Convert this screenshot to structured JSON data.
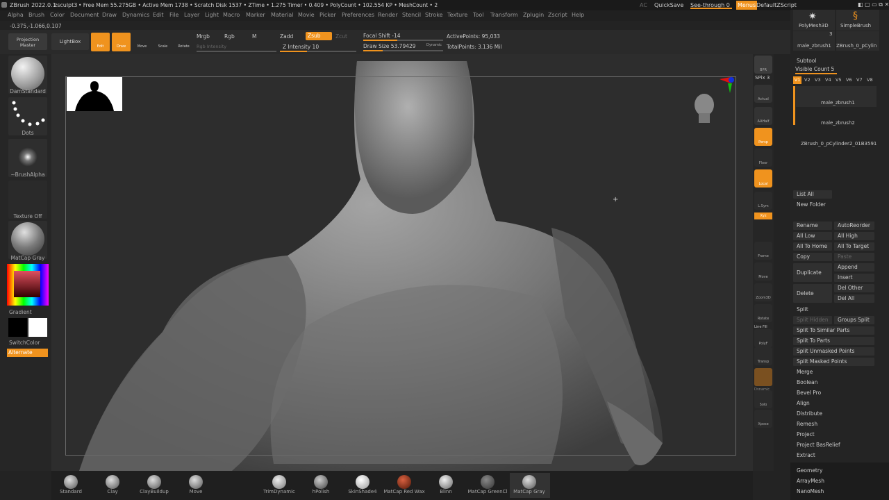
{
  "titlebar": {
    "app": "ZBrush 2022.0.1",
    "doc": "zsculpt3",
    "stats": "• Free Mem 55.275GB • Active Mem 1738 • Scratch Disk 1537 • ZTime • 1.275 Timer • 0.409 • PolyCount • 102.554 KP • MeshCount • 2",
    "ac": "AC",
    "quicksave": "QuickSave",
    "seethrough": "See-through",
    "seethrough_val": "0",
    "menus": "Menus",
    "script": "DefaultZScript"
  },
  "menu": [
    "Alpha",
    "Brush",
    "Color",
    "Document",
    "Draw",
    "Dynamics",
    "Edit",
    "File",
    "Layer",
    "Light",
    "Macro",
    "Marker",
    "Material",
    "Movie",
    "Picker",
    "Preferences",
    "Render",
    "Stencil",
    "Stroke",
    "Texture",
    "Tool",
    "Transform",
    "Zplugin",
    "Zscript",
    "Help"
  ],
  "coord": "-0.375,-1.066,0.107",
  "toolbar": {
    "projection_master": "Projection Master",
    "lightbox": "LightBox",
    "edit": "Edit",
    "draw": "Draw",
    "move": "Move",
    "scale": "Scale",
    "rotate": "Rotate",
    "mrgb": "Mrgb",
    "rgb": "Rgb",
    "m": "M",
    "rgb_intensity": "Rgb Intensity",
    "zadd": "Zadd",
    "zsub": "Zsub",
    "zcut": "Zcut",
    "z_intensity": "Z Intensity 10",
    "z_intensity_level": 0.35,
    "focal_shift": "Focal Shift -14",
    "focal_shift_level": 0.43,
    "draw_size": "Draw Size 53.79429",
    "draw_size_level": 0.24,
    "dynamic": "Dynamic",
    "active_points": "ActivePoints: 95,033",
    "total_points": "TotalPoints: 3.136 Mil"
  },
  "left": {
    "brush": "DamStandard",
    "stroke": "Dots",
    "alpha": "~BrushAlpha",
    "texture": "Texture Off",
    "material": "MatCap Gray",
    "gradient": "Gradient",
    "switch": "SwitchColor",
    "alternate": "Alternate"
  },
  "right_shelf": [
    "BPR",
    "SPix 3",
    "Actual",
    "AAHalf",
    "Persp",
    "Floor",
    "Local",
    "L.Sym",
    "Xyz",
    "Frame",
    "Move",
    "Zoom3D",
    "Rotate",
    "Line Fill",
    "PolyF",
    "Transp",
    "Dynamic",
    "Solo",
    "Xpose"
  ],
  "tray": {
    "polymesh": "PolyMesh3D",
    "simplebrush": "SimpleBrush",
    "male1": "male_zbrush1",
    "count3": "3",
    "pcyl": "ZBrush_0_pCylin",
    "subtool": "Subtool",
    "visible_count": "Visible Count 5",
    "versions": [
      "V1",
      "V2",
      "V3",
      "V4",
      "V5",
      "V6",
      "V7",
      "V8"
    ],
    "items": [
      "male_zbrush1",
      "male_zbrush2",
      "ZBrush_0_pCylinder2_01B3591"
    ],
    "list_all": "List All",
    "new_folder": "New Folder",
    "rename": "Rename",
    "autoreorder": "AutoReorder",
    "all_low": "All Low",
    "all_high": "All High",
    "all_home": "All To Home",
    "all_target": "All To Target",
    "copy": "Copy",
    "paste": "Paste",
    "duplicate": "Duplicate",
    "append": "Append",
    "insert": "Insert",
    "delete": "Delete",
    "del_other": "Del Other",
    "del_all": "Del All",
    "split": "Split",
    "split_hidden": "Split Hidden",
    "groups_split": "Groups Split",
    "split_similar": "Split To Similar Parts",
    "split_parts": "Split To Parts",
    "split_unmasked": "Split Unmasked Points",
    "split_masked": "Split Masked Points",
    "merge": "Merge",
    "boolean": "Boolean",
    "bevel": "Bevel Pro",
    "align": "Align",
    "distribute": "Distribute",
    "remesh": "Remesh",
    "project": "Project",
    "project_bas": "Project BasRelief",
    "extract": "Extract",
    "geometry": "Geometry",
    "arraymesh": "ArrayMesh",
    "nanomesh": "NanoMesh"
  },
  "bottom": {
    "brushes": [
      "Standard",
      "Clay",
      "ClayBuildup",
      "Move",
      "TrimDynamic",
      "hPolish",
      "SkinShade4",
      "MatCap Red Wax",
      "Blinn",
      "MatCap GreenCl",
      "MatCap Gray"
    ]
  },
  "colors": {
    "accent": "#f0931e",
    "bg": "#232323"
  }
}
